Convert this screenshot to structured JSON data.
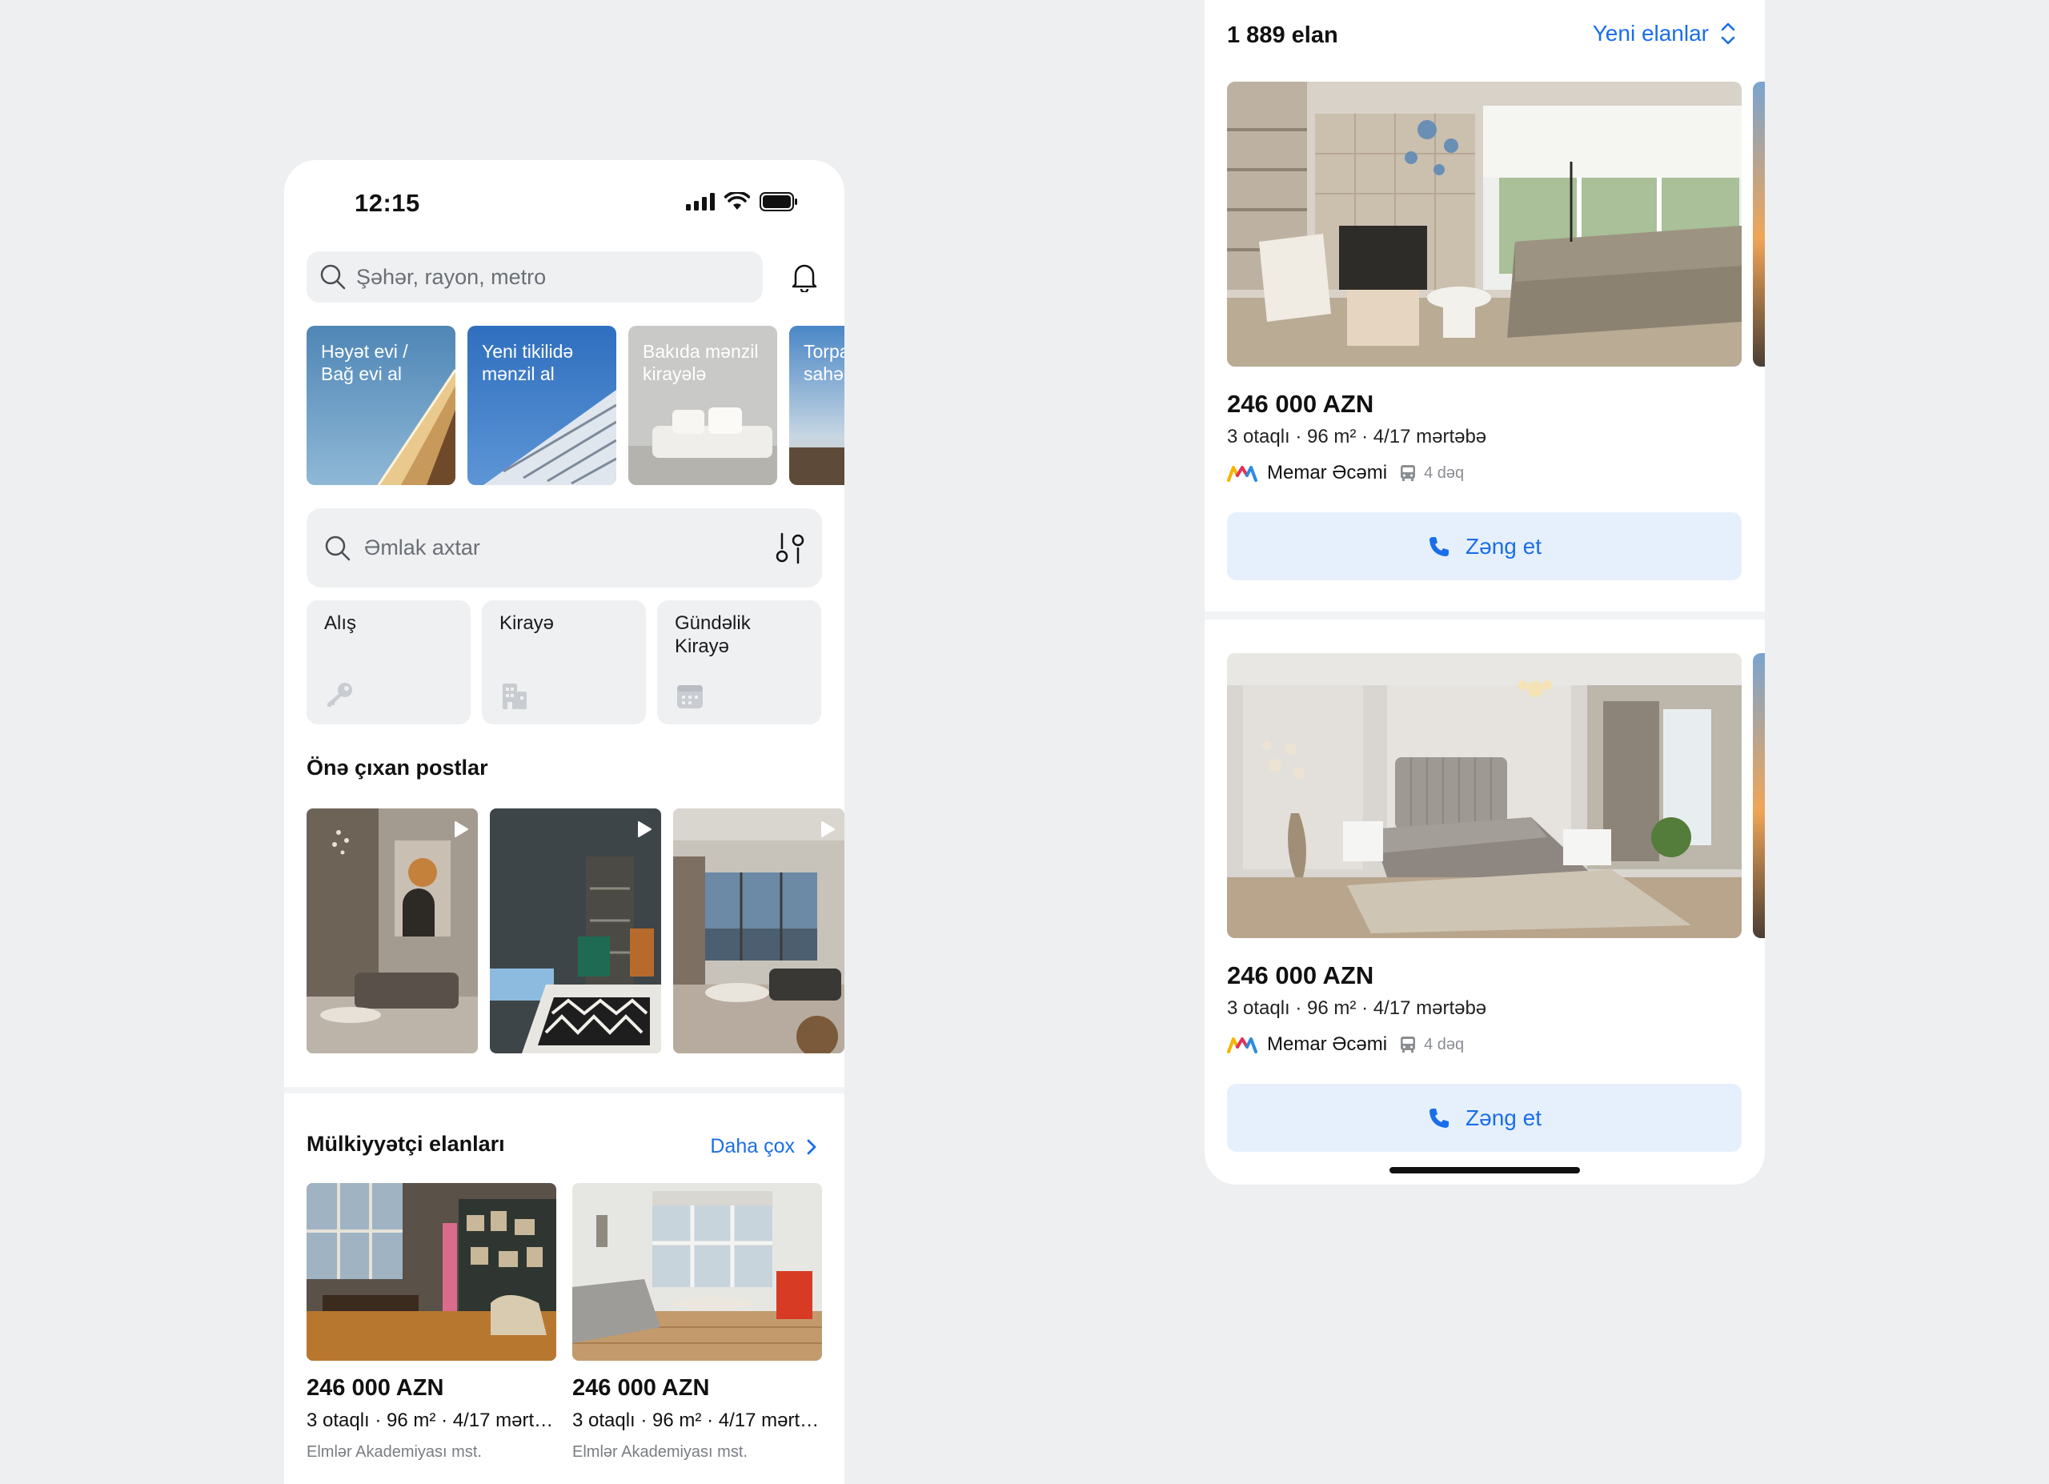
{
  "left_screen": {
    "status": {
      "time": "12:15"
    },
    "search": {
      "placeholder": "Şəhər, rayon, metro"
    },
    "categories": [
      {
        "label": "Həyət evi /\nBağ evi al"
      },
      {
        "label": "Yeni tikilidə\nmənzil al"
      },
      {
        "label": "Bakıda mənzil\nkirayələ"
      },
      {
        "label": "Torpa\nsahə"
      }
    ],
    "property_search": {
      "placeholder": "Əmlak axtar"
    },
    "deal_types": [
      {
        "label": "Alış",
        "icon": "key-icon"
      },
      {
        "label": "Kirayə",
        "icon": "building-icon"
      },
      {
        "label": "Gündəlik\nKirayə",
        "icon": "calendar-icon"
      }
    ],
    "featured": {
      "title": "Önə çıxan postlar"
    },
    "owners": {
      "title": "Mülkiyyətçi elanları",
      "more_label": "Daha çox",
      "items": [
        {
          "price": "246 000 AZN",
          "meta": "3 otaqlı · 96 m² · 4/17 mərtə...",
          "location": "Elmlər Akademiyası mst."
        },
        {
          "price": "246 000 AZN",
          "meta": "3 otaqlı · 96 m² · 4/17 mərtə...",
          "location": "Elmlər Akademiyası mst."
        }
      ]
    }
  },
  "right_screen": {
    "count": "1 889 elan",
    "sort_label": "Yeni elanlar",
    "listings": [
      {
        "price": "246 000 AZN",
        "meta": "3 otaqlı · 96 m² · 4/17 mərtəbə",
        "agency": "Memar Əcəmi",
        "transit": "4 dəq",
        "call_label": "Zəng et"
      },
      {
        "price": "246 000 AZN",
        "meta": "3 otaqlı · 96 m² · 4/17 mərtəbə",
        "agency": "Memar Əcəmi",
        "transit": "4 dəq",
        "call_label": "Zəng et"
      }
    ]
  },
  "colors": {
    "accent": "#1a6ee8",
    "surface": "#eef0f2",
    "call_bg": "#e6f0fd",
    "background": "#eeeff1"
  }
}
